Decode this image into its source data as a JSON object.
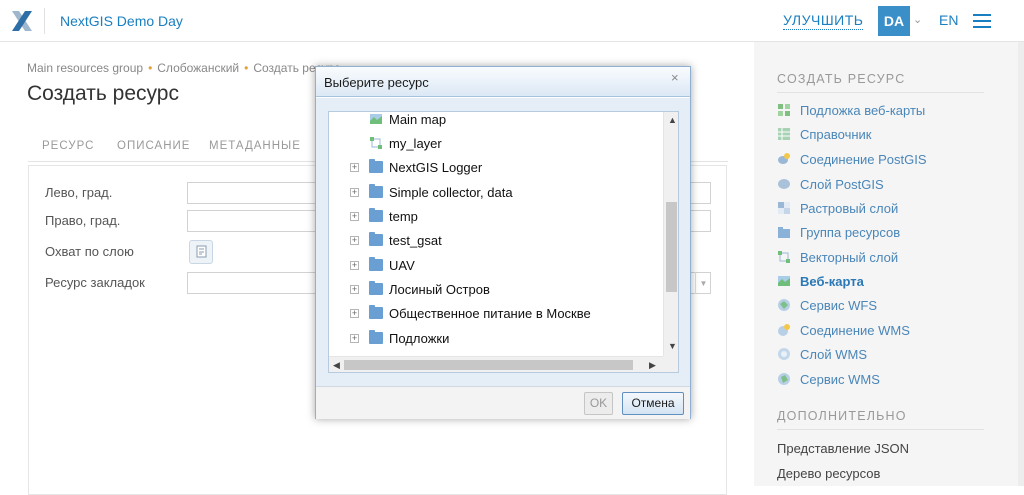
{
  "header": {
    "app_title": "NextGIS Demo Day",
    "upgrade": "УЛУЧШИТЬ",
    "avatar": "DA",
    "lang": "EN"
  },
  "breadcrumb": {
    "items": [
      "Main resources group",
      "Слобожанский",
      "Создать ресурс"
    ]
  },
  "page": {
    "title": "Создать ресурс"
  },
  "tabs": [
    "РЕСУРС",
    "ОПИСАНИЕ",
    "МЕТАДАННЫЕ"
  ],
  "form": {
    "fields": [
      "Лево, град.",
      "Право, град.",
      "Охват по слою",
      "Ресурс закладок"
    ]
  },
  "sidebar": {
    "create_header": "СОЗДАТЬ РЕСУРС",
    "items": [
      {
        "label": "Подложка веб-карты",
        "icon": "basemap-icon"
      },
      {
        "label": "Справочник",
        "icon": "lookup-table-icon"
      },
      {
        "label": "Соединение PostGIS",
        "icon": "postgis-connection-icon"
      },
      {
        "label": "Слой PostGIS",
        "icon": "postgis-layer-icon"
      },
      {
        "label": "Растровый слой",
        "icon": "raster-layer-icon"
      },
      {
        "label": "Группа ресурсов",
        "icon": "resource-group-icon"
      },
      {
        "label": "Векторный слой",
        "icon": "vector-layer-icon"
      },
      {
        "label": "Веб-карта",
        "icon": "webmap-icon"
      },
      {
        "label": "Сервис WFS",
        "icon": "wfs-service-icon"
      },
      {
        "label": "Соединение WMS",
        "icon": "wms-connection-icon"
      },
      {
        "label": "Слой WMS",
        "icon": "wms-layer-icon"
      },
      {
        "label": "Сервис WMS",
        "icon": "wms-service-icon"
      }
    ],
    "extra_header": "ДОПОЛНИТЕЛЬНО",
    "extra_items": [
      "Представление JSON",
      "Дерево ресурсов"
    ]
  },
  "dialog": {
    "title": "Выберите ресурс",
    "close": "×",
    "tree": [
      {
        "label": "Main map",
        "type": "webmap"
      },
      {
        "label": "my_layer",
        "type": "vector"
      },
      {
        "label": "NextGIS Logger",
        "type": "folder"
      },
      {
        "label": "Simple collector, data",
        "type": "folder"
      },
      {
        "label": "temp",
        "type": "folder"
      },
      {
        "label": "test_gsat",
        "type": "folder"
      },
      {
        "label": "UAV",
        "type": "folder"
      },
      {
        "label": "Лосиный Остров",
        "type": "folder"
      },
      {
        "label": "Общественное питание в Москве",
        "type": "folder"
      },
      {
        "label": "Подложки",
        "type": "folder"
      }
    ],
    "ok": "OK",
    "cancel": "Отмена"
  }
}
